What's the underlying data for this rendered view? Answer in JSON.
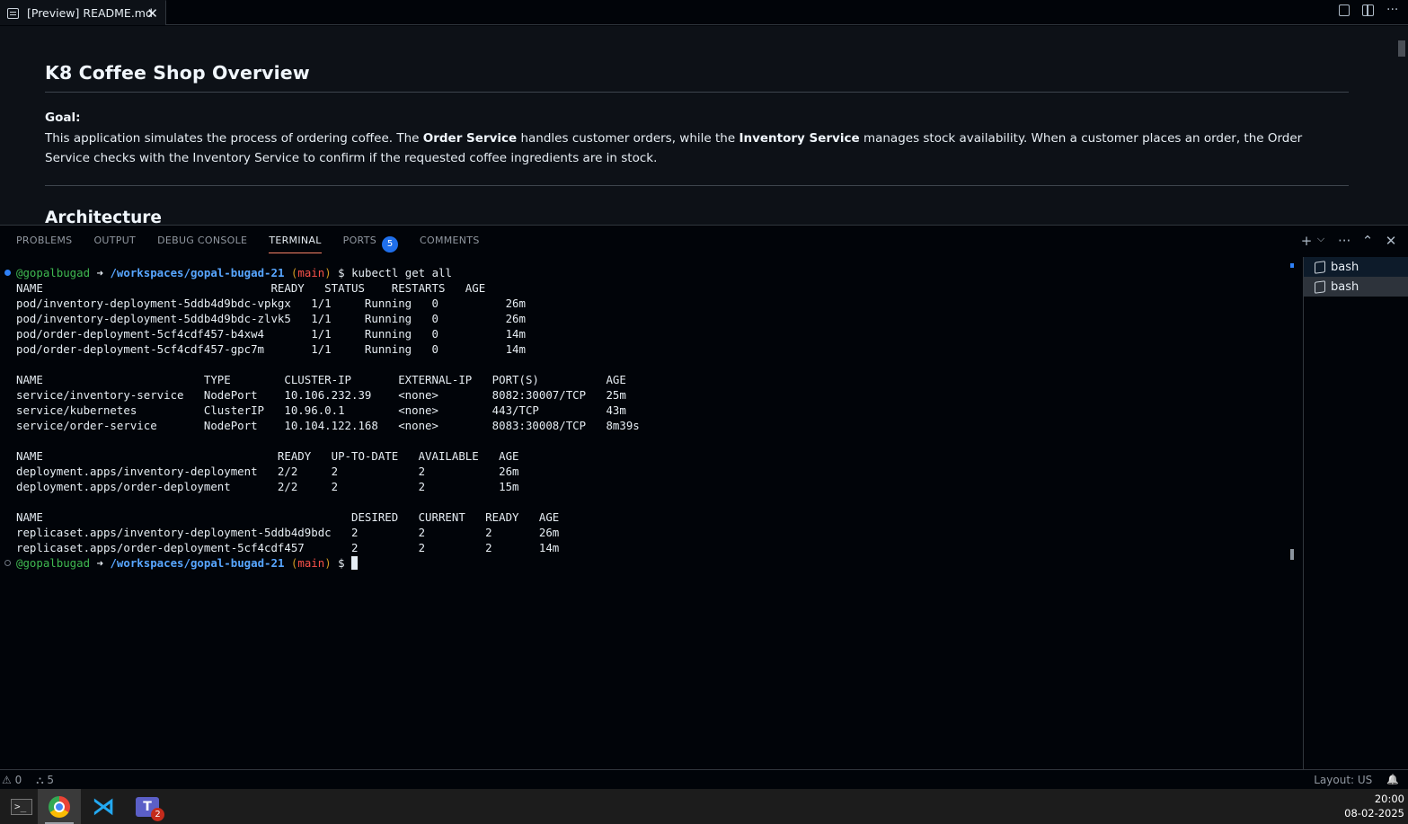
{
  "tab": {
    "title": "[Preview] README.md",
    "close": "✕"
  },
  "preview": {
    "h1": "K8 Coffee Shop Overview",
    "goal_label": "Goal:",
    "para": {
      "p1": "This application simulates the process of ordering coffee. The ",
      "b1": "Order Service",
      "p2": " handles customer orders, while the ",
      "b2": "Inventory Service",
      "p3": " manages stock availability. When a customer places an order, the Order Service checks with the Inventory Service to confirm if the requested coffee ingredients are in stock."
    },
    "h2": "Architecture"
  },
  "panel": {
    "tabs": [
      "PROBLEMS",
      "OUTPUT",
      "DEBUG CONSOLE",
      "TERMINAL",
      "PORTS",
      "COMMENTS"
    ],
    "ports_badge": "5",
    "actions": {
      "add": "+",
      "dropdown": "⌵",
      "more": "···",
      "maximize": "⌃",
      "close": "✕"
    }
  },
  "terminal": {
    "prompt": {
      "user": "@gopalbugad",
      "arrow": " ➜",
      "path": "/workspaces/gopal-bugad-21",
      "branch": "main",
      "dollar": " $ "
    },
    "command": "kubectl get all",
    "output": [
      "NAME                                  READY   STATUS    RESTARTS   AGE",
      "pod/inventory-deployment-5ddb4d9bdc-vpkgx   1/1     Running   0          26m",
      "pod/inventory-deployment-5ddb4d9bdc-zlvk5   1/1     Running   0          26m",
      "pod/order-deployment-5cf4cdf457-b4xw4       1/1     Running   0          14m",
      "pod/order-deployment-5cf4cdf457-gpc7m       1/1     Running   0          14m",
      "",
      "NAME                        TYPE        CLUSTER-IP       EXTERNAL-IP   PORT(S)          AGE",
      "service/inventory-service   NodePort    10.106.232.39    <none>        8082:30007/TCP   25m",
      "service/kubernetes          ClusterIP   10.96.0.1        <none>        443/TCP          43m",
      "service/order-service       NodePort    10.104.122.168   <none>        8083:30008/TCP   8m39s",
      "",
      "NAME                                   READY   UP-TO-DATE   AVAILABLE   AGE",
      "deployment.apps/inventory-deployment   2/2     2            2           26m",
      "deployment.apps/order-deployment       2/2     2            2           15m",
      "",
      "NAME                                              DESIRED   CURRENT   READY   AGE",
      "replicaset.apps/inventory-deployment-5ddb4d9bdc   2         2         2       26m",
      "replicaset.apps/order-deployment-5cf4cdf457       2         2         2       14m"
    ],
    "sessions": [
      "bash",
      "bash"
    ]
  },
  "status": {
    "problems": "⚠ 0",
    "ports": "⛬ 5",
    "layout": "Layout: US",
    "bell": "🔔"
  },
  "taskbar": {
    "teams_badge": "2",
    "time": "20:00",
    "date": "08-02-2025"
  },
  "colors": {
    "accent": "#1f6feb",
    "user": "#3fb950",
    "path": "#58a6ff",
    "branch": "#f85149"
  }
}
